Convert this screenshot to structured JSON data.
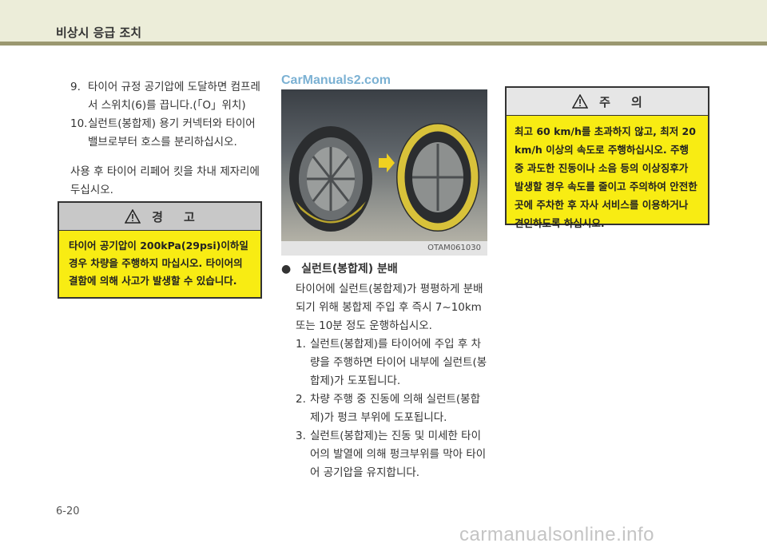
{
  "header": {
    "title": "비상시 응급 조치"
  },
  "watermark_top": "CarManuals2.com",
  "left_steps": [
    {
      "num": "9.",
      "text": "타이어 규정 공기압에 도달하면 컴프레서 스위치(6)를 끕니다.(「O」위치)"
    },
    {
      "num": "10.",
      "text": "실런트(봉합제) 용기 커넥터와 타이어 밸브로부터 호스를 분리하십시오."
    }
  ],
  "left_para": "사용 후 타이어 리페어 킷을 차내 제자리에 두십시오.",
  "warning": {
    "heading": "경     고",
    "body": "타이어 공기압이 200kPa(29psi)이하일 경우 차량을 주행하지 마십시오. 타이어의 결함에 의해 사고가 발생할 수 있습니다."
  },
  "photo": {
    "id_label": "OTAM061030"
  },
  "section": {
    "bullet": "●",
    "title": "실런트(봉합제) 분배",
    "intro": "타이어에 실런트(봉합제)가 평평하게 분배되기 위해 봉합제 주입 후 즉시 7~10km 또는 10분 정도 운행하십시오.",
    "steps": [
      {
        "num": "1.",
        "text": "실런트(봉합제)를 타이어에 주입 후 차량을 주행하면 타이어 내부에 실런트(봉합제)가 도포됩니다."
      },
      {
        "num": "2.",
        "text": "차량 주행 중 진동에 의해 실런트(봉합제)가 펑크 부위에 도포됩니다."
      },
      {
        "num": "3.",
        "text": "실런트(봉합제)는 진동 및 미세한 타이어의 발열에 의해 펑크부위를 막아 타이어 공기압을 유지합니다."
      }
    ]
  },
  "caution": {
    "heading": "주     의",
    "body": "최고 60 km/h를 초과하지 않고, 최저 20 km/h 이상의 속도로 주행하십시오. 주행 중 과도한 진동이나 소음 등의 이상징후가 발생할 경우 속도를 줄이고 주의하여 안전한 곳에 주차한 후 자사 서비스를 이용하거나 견인하도록 하십시오."
  },
  "page_number": "6-20",
  "footer_watermark": "carmanualsonline.info",
  "colors": {
    "header_bg": "#ecedd9",
    "header_rule": "#9b9870",
    "box_yellow": "#f8ec13"
  }
}
